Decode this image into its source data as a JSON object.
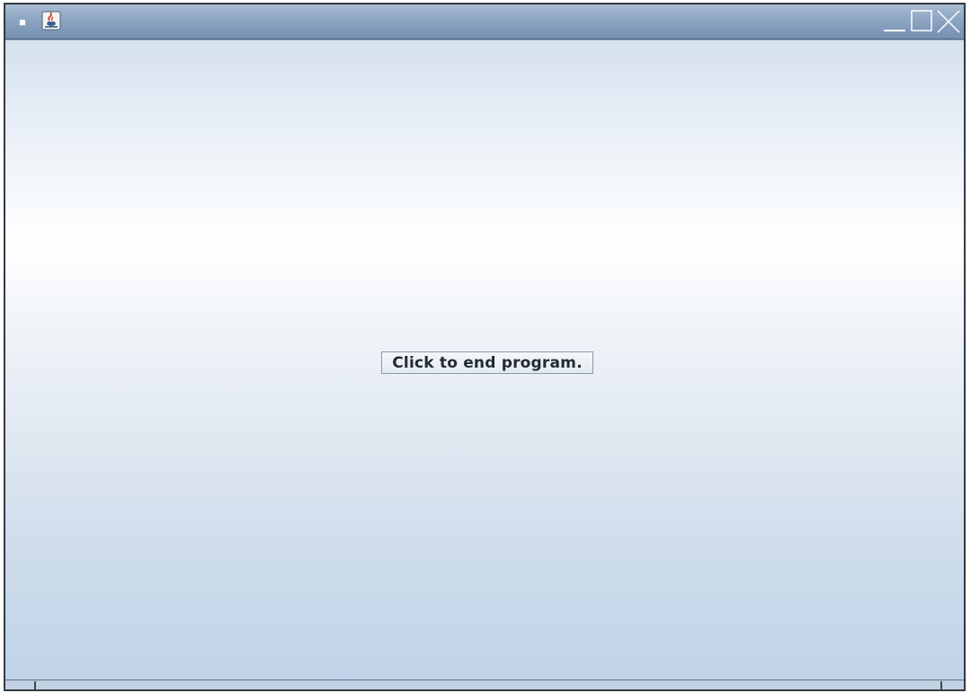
{
  "window": {
    "title": "",
    "icons": {
      "system_menu": "window-menu-icon",
      "app": "java-cup-icon",
      "minimize": "minimize-icon",
      "maximize": "maximize-icon",
      "close": "close-icon"
    }
  },
  "main": {
    "button_label": "Click to end program."
  },
  "colors": {
    "titlebar": "#8fa7c3",
    "window_border": "#333a44",
    "content_top": "#d5e1ee",
    "content_highlight": "#ffffff",
    "content_bottom": "#c0d3e8",
    "button_text": "#222a33"
  }
}
